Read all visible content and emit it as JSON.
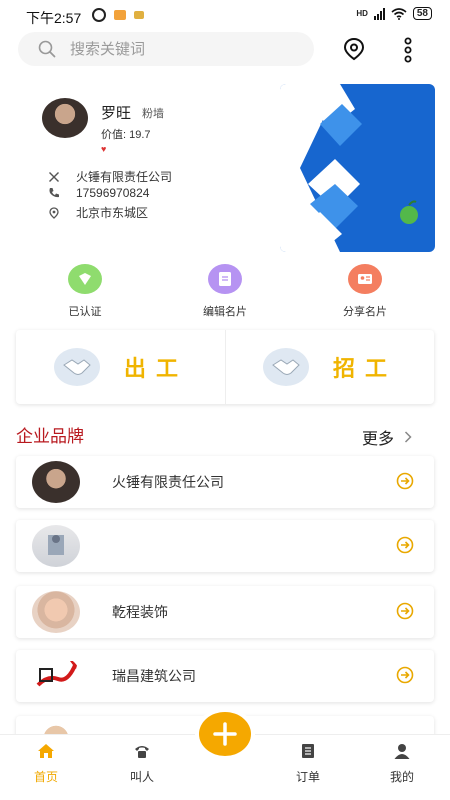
{
  "status_bar": {
    "time": "下午2:57",
    "network": "HD",
    "battery": "58"
  },
  "search": {
    "placeholder": "搜索关键词"
  },
  "profile": {
    "name": "罗旺",
    "tag": "粉墙",
    "value": "价值: 19.7",
    "company": "火锤有限责任公司",
    "phone": "17596970824",
    "address": "北京市东城区"
  },
  "quick_actions": [
    {
      "label": "已认证",
      "icon": "verified-icon",
      "color": "#7ed36b"
    },
    {
      "label": "编辑名片",
      "icon": "edit-card-icon",
      "color": "#b08cf0"
    },
    {
      "label": "分享名片",
      "icon": "share-card-icon",
      "color": "#f2785c"
    }
  ],
  "work": {
    "out_label": "出工",
    "hire_label": "招工"
  },
  "section": {
    "title": "企业品牌",
    "more": "更多"
  },
  "brands": [
    {
      "name": "火锤有限责任公司"
    },
    {
      "name": ""
    },
    {
      "name": "乾程装饰"
    },
    {
      "name": "瑞昌建筑公司"
    }
  ],
  "nav": [
    {
      "label": "首页",
      "icon": "home-icon"
    },
    {
      "label": "叫人",
      "icon": "phone-icon"
    },
    {
      "label": "订单",
      "icon": "order-icon"
    },
    {
      "label": "我的",
      "icon": "user-icon"
    }
  ],
  "colors": {
    "accent": "#f5a800",
    "section_title": "#b8191f",
    "work_text": "#f0b400",
    "banner": "#1a6fd1"
  }
}
